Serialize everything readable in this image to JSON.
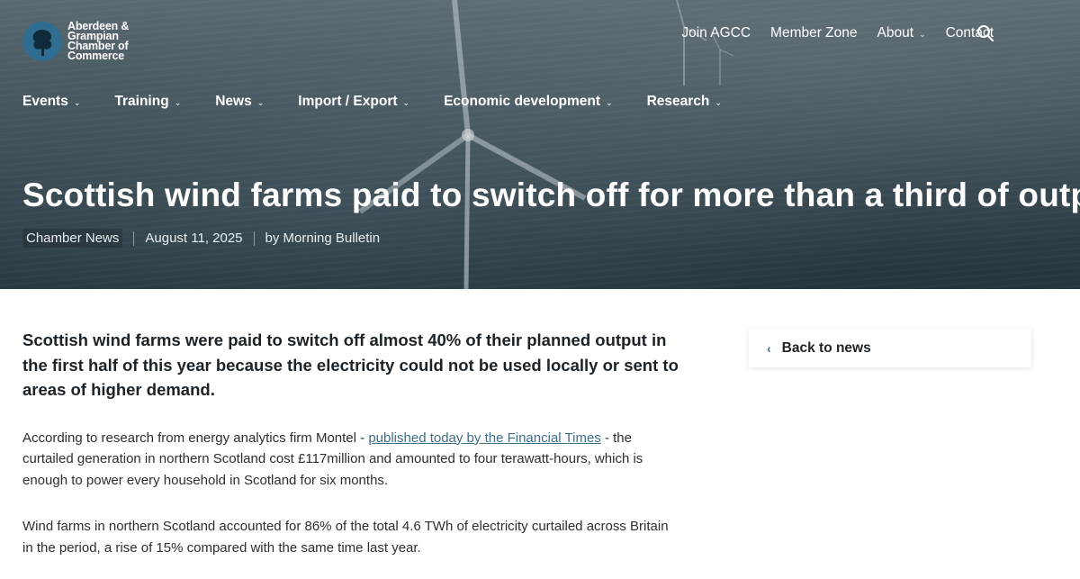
{
  "brand": {
    "name_lines": [
      "Aberdeen &",
      "Grampian",
      "Chamber of",
      "Commerce"
    ]
  },
  "top_nav": {
    "items": [
      "Join AGCC",
      "Member Zone",
      "About",
      "Contact"
    ],
    "search_icon": "search-icon"
  },
  "main_nav": {
    "items": [
      "Events",
      "Training",
      "News",
      "Import / Export",
      "Economic development",
      "Research"
    ]
  },
  "article": {
    "title": "Scottish wind farms paid to switch off for more than a third of output",
    "category": "Chamber News",
    "date": "August 11, 2025",
    "byline": "by Morning Bulletin",
    "lead": "Scottish wind farms were paid to switch off almost 40% of their planned output in the first half of this year because the electricity could not be used locally or sent to areas of higher demand.",
    "p1_before": "According to research from energy analytics firm Montel - ",
    "p1_link": "published today by the Financial Times",
    "p1_after": " - the curtailed generation in northern Scotland cost £117million and amounted to four terawatt-hours, which is enough to power every household in Scotland for six months.",
    "p2": "Wind farms in northern Scotland accounted for 86% of the total 4.6 TWh of electricity curtailed across Britain in the period, a rise of 15% compared with the same time last year."
  },
  "sidebar": {
    "back_label": "Back to news"
  },
  "colors": {
    "link": "#3f6f87",
    "logo_blue": "#2f6d91"
  }
}
